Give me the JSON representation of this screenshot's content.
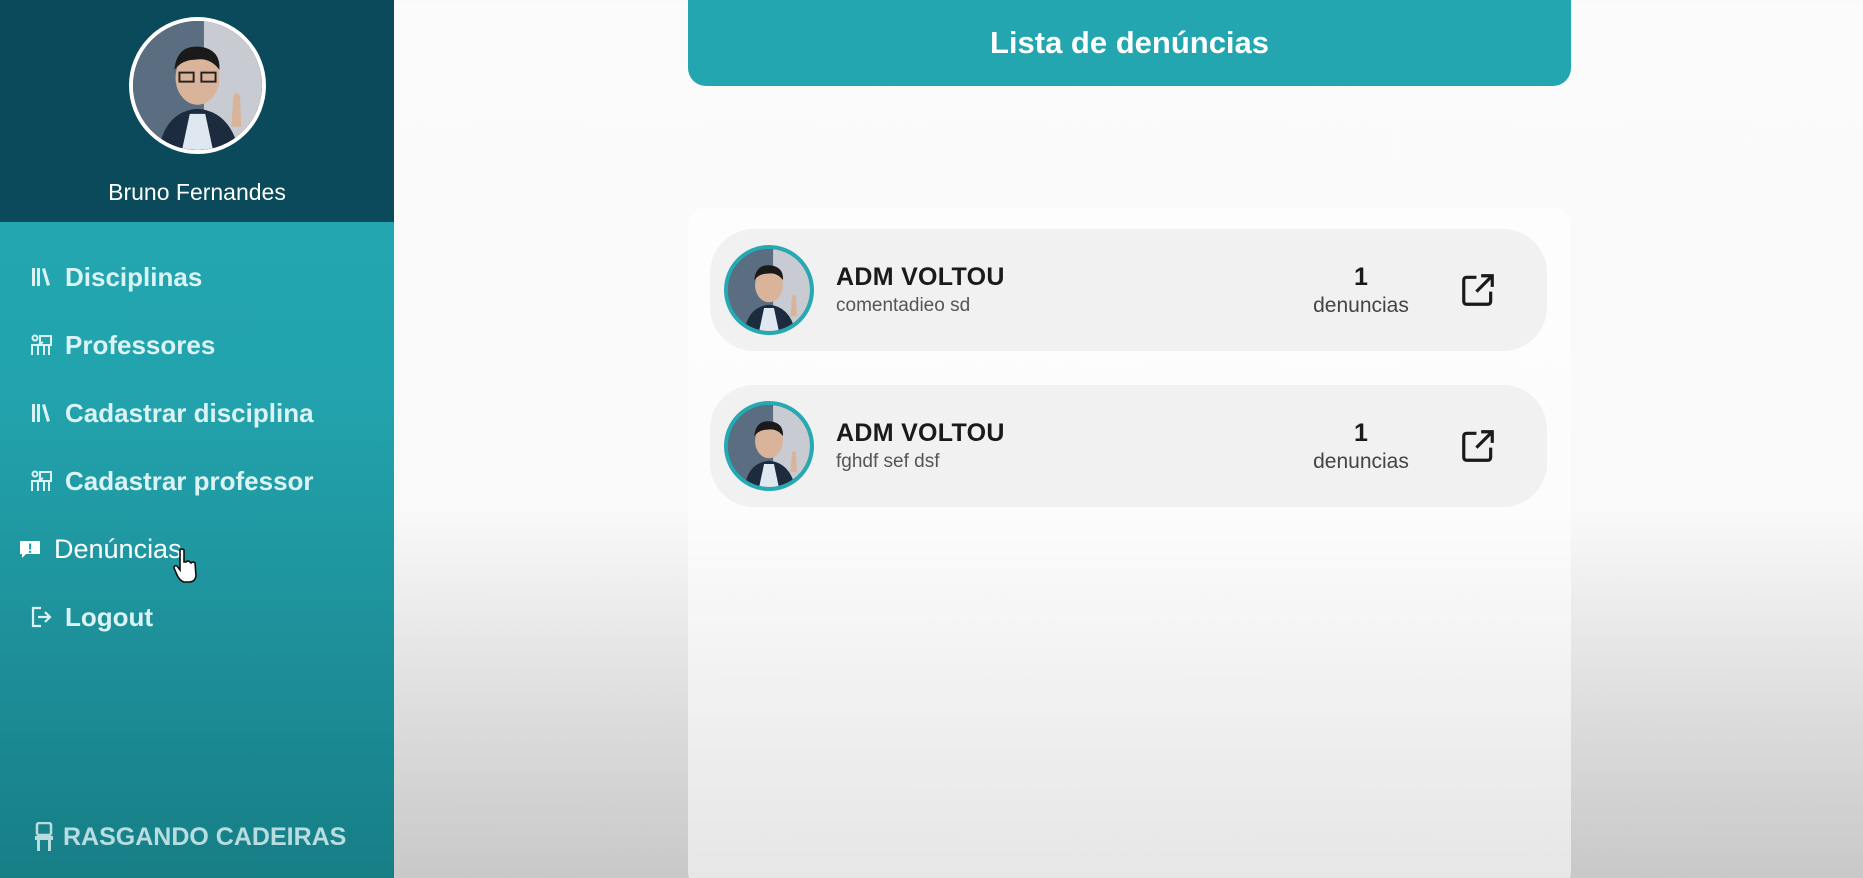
{
  "sidebar": {
    "user_name": "Bruno Fernandes",
    "items": [
      {
        "label": "Disciplinas",
        "icon": "books-icon"
      },
      {
        "label": "Professores",
        "icon": "teacher-board-icon"
      },
      {
        "label": "Cadastrar disciplina",
        "icon": "books-icon"
      },
      {
        "label": "Cadastrar professor",
        "icon": "teacher-board-icon"
      },
      {
        "label": "Denúncias",
        "icon": "report-icon",
        "active": true
      },
      {
        "label": "Logout",
        "icon": "logout-icon"
      }
    ],
    "brand": "RASGANDO CADEIRAS"
  },
  "main": {
    "title": "Lista de denúncias",
    "reports": [
      {
        "title": "ADM VOLTOU",
        "subtitle": "comentadieo sd",
        "count": "1",
        "count_label": "denuncias"
      },
      {
        "title": "ADM VOLTOU",
        "subtitle": "fghdf sef dsf",
        "count": "1",
        "count_label": "denuncias"
      }
    ]
  },
  "colors": {
    "accent": "#23a6b0",
    "sidebar_header": "#0b4a5b",
    "card_bg": "#f1f1f1"
  }
}
